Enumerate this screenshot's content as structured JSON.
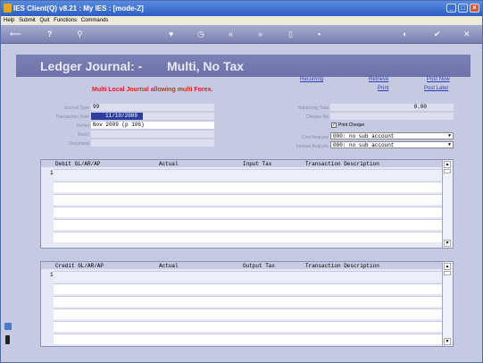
{
  "window": {
    "title": "IES Client(Q) v8.21 : My IES :     [mode-Z]"
  },
  "menu": [
    "Help",
    "Submit",
    "Quit",
    "Functions",
    "Commands"
  ],
  "header": {
    "title_left": "Ledger Journal: -",
    "title_right": "Multi, No Tax"
  },
  "links": {
    "recurring": "Recurring",
    "retrieve": "Retrieve",
    "post_now": "Post Now",
    "print": "Print",
    "post_later": "Post Later"
  },
  "warning": "Multi Local Journal allowing multi Forex.",
  "form": {
    "journal_type_label": "Journal Type",
    "journal_type_value": "99",
    "transaction_date_label": "Transaction Date",
    "transaction_date_value": "11/10/2009",
    "period_label": "Period",
    "period_value": "Nov 2009 (p 106)",
    "batch_label": "Batch",
    "document_label": "Document",
    "balancing_total_label": "Balancing Total",
    "balancing_total_value": "0.00",
    "cheque_no_label": "Cheque No",
    "print_cheque_label": "Print Cheque",
    "cost_analysis_label": "Cost Analysis",
    "cost_analysis_value": "000: no sub account",
    "income_analysis_label": "Income Analysis",
    "income_analysis_value": "000: no sub account"
  },
  "debit_grid": {
    "headers": [
      "Debit GL/AR/AP",
      "Actual",
      "Input Tax",
      "Transaction Description"
    ],
    "row_number": "1"
  },
  "credit_grid": {
    "headers": [
      "Credit GL/AR/AP",
      "Actual",
      "Output Tax",
      "Transaction Description"
    ],
    "row_number": "1"
  }
}
